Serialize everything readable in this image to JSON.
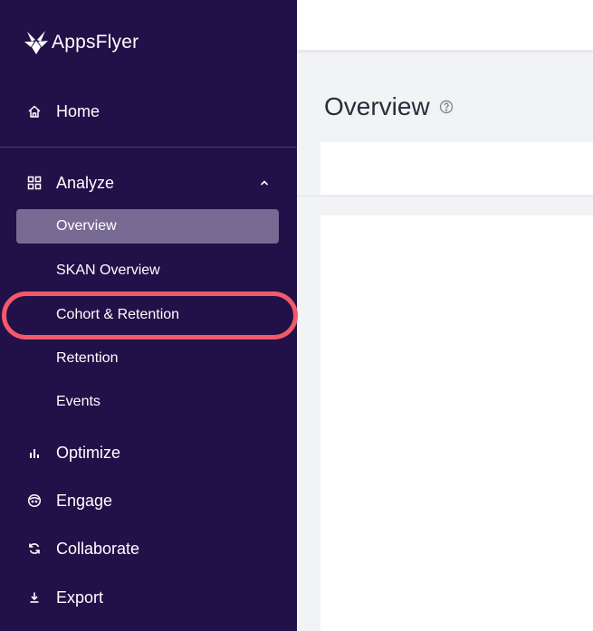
{
  "brand": {
    "name": "AppsFlyer",
    "logo_icon": "appsflyer-logo-icon"
  },
  "sidebar": {
    "home": {
      "label": "Home",
      "icon": "home-icon"
    },
    "analyze": {
      "label": "Analyze",
      "icon": "grid-icon",
      "expanded": true,
      "items": [
        {
          "label": "Overview",
          "active": true
        },
        {
          "label": "SKAN Overview"
        },
        {
          "label": "Cohort & Retention",
          "highlighted": true
        },
        {
          "label": "Retention"
        },
        {
          "label": "Events"
        }
      ]
    },
    "optimize": {
      "label": "Optimize",
      "icon": "bar-chart-icon"
    },
    "engage": {
      "label": "Engage",
      "icon": "face-icon"
    },
    "collaborate": {
      "label": "Collaborate",
      "icon": "sync-icon"
    },
    "export": {
      "label": "Export",
      "icon": "download-icon"
    }
  },
  "main": {
    "title": "Overview",
    "help_icon": "help-circle-icon"
  },
  "colors": {
    "sidebar_bg": "#221048",
    "active_item_bg": "#776a93",
    "highlight": "#f25a68",
    "page_bg": "#f2f3f5"
  }
}
